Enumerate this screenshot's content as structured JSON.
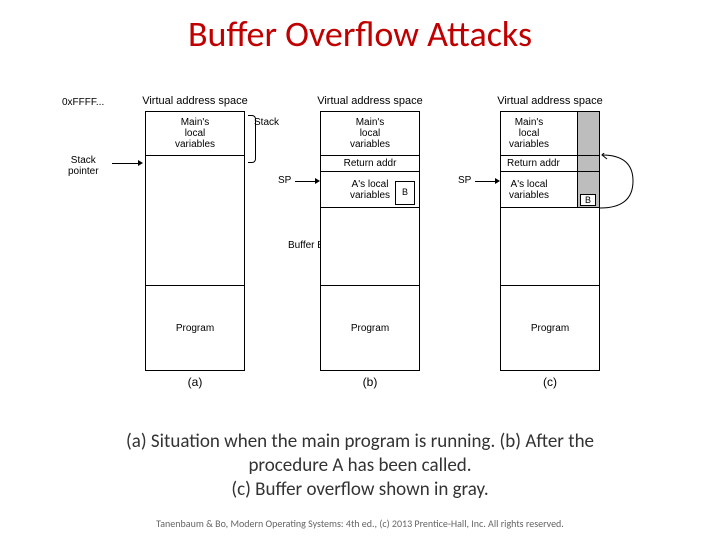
{
  "title": "Buffer Overflow Attacks",
  "caption_line1": "(a) Situation when the main program is running. (b) After the",
  "caption_line2": "procedure A has been called.",
  "caption_line3": "(c) Buffer overflow shown in gray.",
  "footer": "Tanenbaum & Bo, Modern Operating Systems: 4th ed., (c) 2013 Prentice-Hall, Inc. All rights reserved.",
  "fig": {
    "header": "Virtual address space",
    "hexlabel": "0xFFFF...",
    "stackptr": "Stack\npointer",
    "sp": "SP",
    "stack": "Stack",
    "bufferb": "Buffer B",
    "mainvars": "Main's\nlocal\nvariables",
    "retaddr": "Return addr",
    "alocal": "A's local\nvariables",
    "program": "Program",
    "b": "B",
    "sub_a": "(a)",
    "sub_b": "(b)",
    "sub_c": "(c)"
  }
}
